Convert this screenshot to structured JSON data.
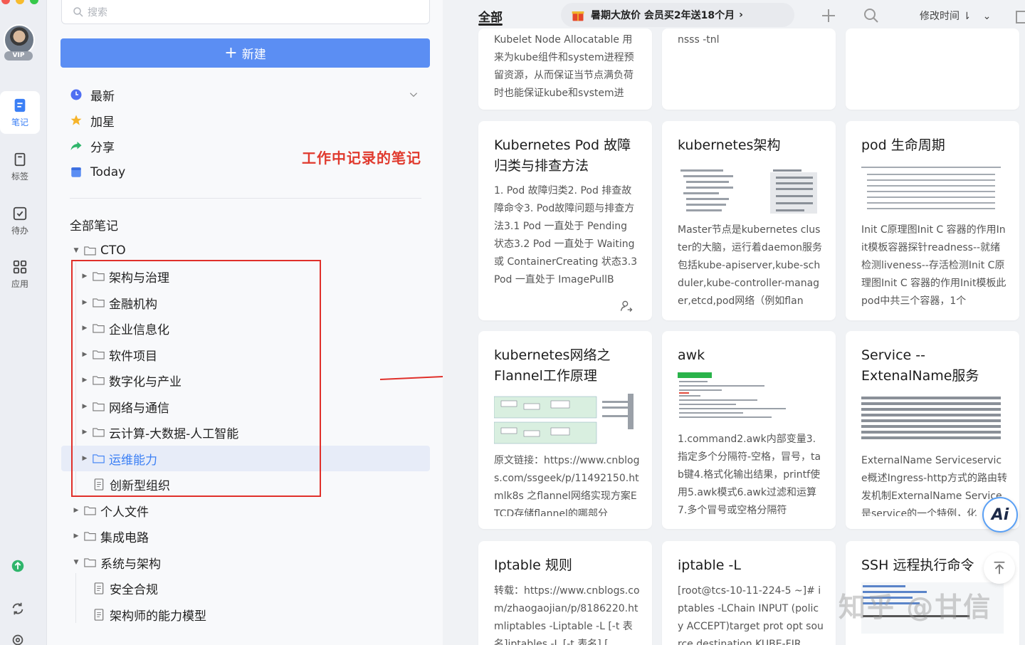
{
  "rail": {
    "vip": "VIP",
    "items": [
      {
        "label": "笔记",
        "icon": "note-icon"
      },
      {
        "label": "标签",
        "icon": "tag-icon"
      },
      {
        "label": "待办",
        "icon": "todo-icon"
      },
      {
        "label": "应用",
        "icon": "apps-icon"
      }
    ]
  },
  "sidebar": {
    "search_placeholder": "搜索",
    "new_button": "新建",
    "quick": [
      "最新",
      "加星",
      "分享",
      "Today"
    ],
    "section_title": "全部笔记",
    "annotation": "工作中记录的笔记",
    "tree": {
      "cto": "CTO",
      "cto_children": [
        "架构与治理",
        "金融机构",
        "企业信息化",
        "软件项目",
        "数字化与产业",
        "网络与通信",
        "云计算-大数据-人工智能",
        "运维能力",
        "创新型组织"
      ],
      "personal": "个人文件",
      "ic": "集成电路",
      "sys": "系统与架构",
      "sys_children": [
        "安全合规",
        "架构师的能力模型"
      ]
    }
  },
  "main": {
    "tab_all": "全部",
    "promo": "暑期大放价 会员买2年送18个月",
    "sort": "修改时间",
    "ai": "Ai",
    "watermark": "知乎 @甘信",
    "cards_top": [
      {
        "body": "Kubelet Node Allocatable 用来为kube组件和system进程预留资源，从而保证当节点满负荷时也能保证kube和system进"
      },
      {
        "body": "nsss -tnl"
      },
      {
        "body": ""
      }
    ],
    "cards": [
      {
        "title": "Kubernetes Pod 故障归类与排查方法",
        "body": "1. Pod 故障归类2. Pod 排查故障命令3. Pod故障问题与排查方法3.1 Pod 一直处于 Pending 状态3.2 Pod 一直处于 Waiting 或 ContainerCreating 状态3.3 Pod 一直处于 ImagePullB"
      },
      {
        "title": "kubernetes架构",
        "body": "Master节点是kubernetes cluster的大脑，运行着daemon服务包括kube-apiserver,kube-schduler,kube-controller-manager,etcd,pod网络（例如flan"
      },
      {
        "title": "pod 生命周期",
        "body": "Init C原理图Init C 容器的作用Init模板容器探针readness--就绪检测liveness--存活检测Init C原理图Init C 容器的作用Init模板此pod中共三个容器，1个"
      },
      {
        "title": "kubernetes网络之Flannel工作原理",
        "body": "原文链接：https://www.cnblogs.com/ssgeek/p/11492150.htmlk8s 之flannel网络实现方案ETCD存储flannel的哪部分"
      },
      {
        "title": "awk",
        "body": "1.command2.awk内部变量3.指定多个分隔符-空格，冒号，tab键4.格式化输出结果，printf使用5.awk模式6.awk过滤和运算7.多个冒号或空格分隔符"
      },
      {
        "title": "Service --ExtenalName服务",
        "body": "ExternalName Serviceservice概述Ingress-http方式的路由转发机制ExternalName Service是service的一个特例，化"
      },
      {
        "title": "Iptable 规则",
        "body": "转载：https://www.cnblogs.com/zhaogaojian/p/8186220.htmliptables -Liptable -L [-t 表名]iptables -L [-t 表名] ["
      },
      {
        "title": "iptable -L",
        "body": "[root@tcs-10-11-224-5 ~]# iptables -LChain INPUT (policy ACCEPT)target prot opt source destination KUBE-FIR"
      },
      {
        "title": "SSH 远程执行命令",
        "body": ""
      }
    ]
  },
  "colors": {
    "accent": "#5b8ef3",
    "annotation": "#e03a2e",
    "selected": "#3b7ff5"
  }
}
